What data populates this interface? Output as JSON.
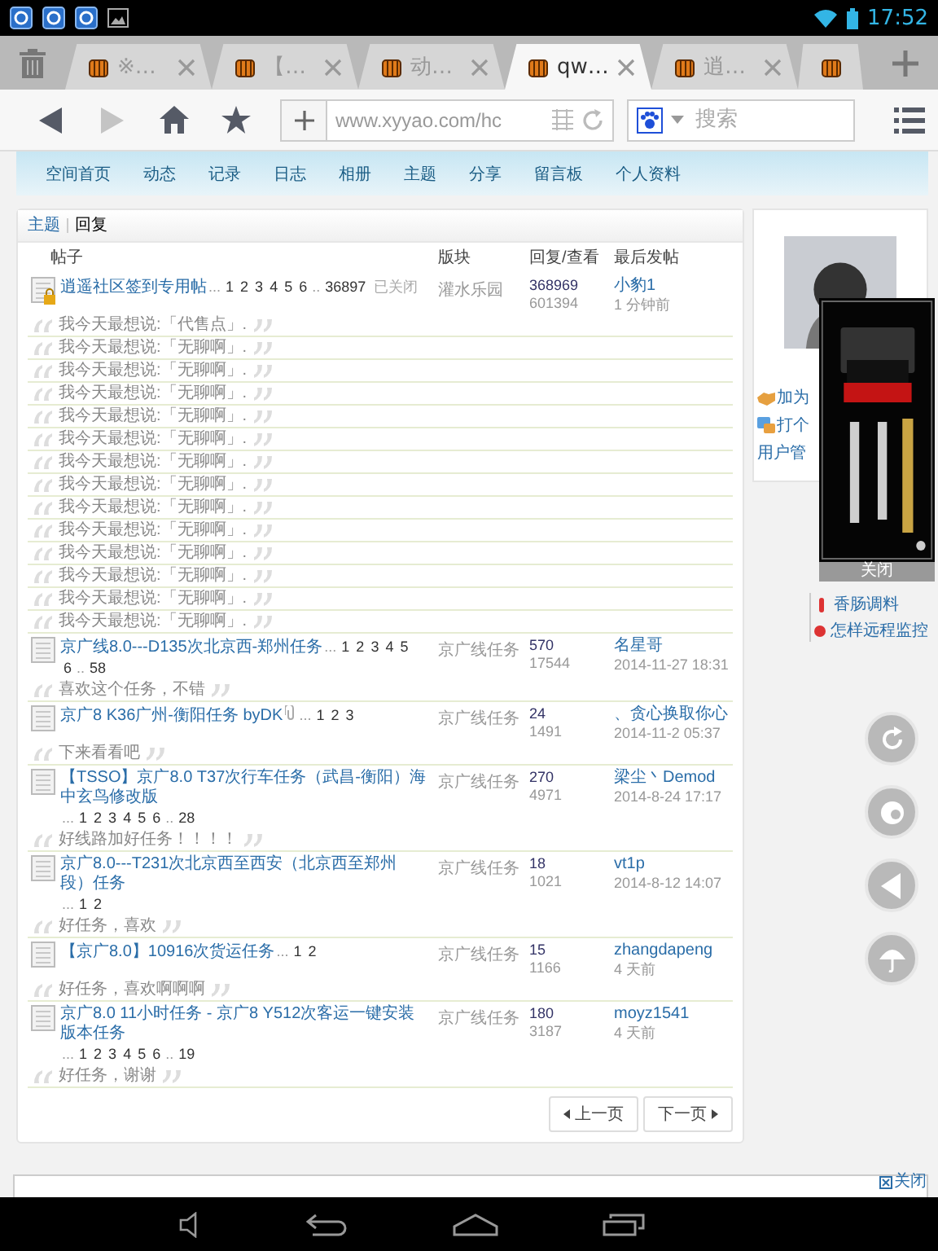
{
  "status_bar": {
    "time": "17:52"
  },
  "browser_tabs": [
    {
      "title": "※…",
      "selected": false
    },
    {
      "title": "【…",
      "selected": false
    },
    {
      "title": "动…",
      "selected": false
    },
    {
      "title": "qw…",
      "selected": true
    },
    {
      "title": "逍…",
      "selected": false
    },
    {
      "selected": false
    }
  ],
  "toolbar": {
    "forward_disabled": true,
    "address": "www.xyyao.com/hc",
    "search": {
      "placeholder": "搜索"
    }
  },
  "nav": [
    "空间首页",
    "动态",
    "记录",
    "日志",
    "相册",
    "主题",
    "分享",
    "留言板",
    "个人资料"
  ],
  "breadcrumb": {
    "link": "主题",
    "current": "回复"
  },
  "columns": [
    "帖子",
    "版块",
    "回复/查看",
    "最后发帖"
  ],
  "threads": [
    {
      "title": "逍遥社区签到专用帖",
      "locked": true,
      "attachment": false,
      "pages": [
        {
          "kind": "gap",
          "text": "..."
        },
        {
          "kind": "page",
          "text": "1"
        },
        {
          "kind": "page",
          "text": "2"
        },
        {
          "kind": "page",
          "text": "3"
        },
        {
          "kind": "page",
          "text": "4"
        },
        {
          "kind": "page",
          "text": "5"
        },
        {
          "kind": "page",
          "text": "6"
        },
        {
          "kind": "gap",
          "text": ".."
        },
        {
          "kind": "page",
          "text": "36897"
        }
      ],
      "status": "已关闭",
      "forum": "灌水乐园",
      "replies": "368969",
      "views": "601394",
      "last_poster": "小豹1",
      "last_time": "1 分钟前",
      "quotes": [
        "我今天最想说:「代售点」.",
        "我今天最想说:「无聊啊」.",
        "我今天最想说:「无聊啊」.",
        "我今天最想说:「无聊啊」.",
        "我今天最想说:「无聊啊」.",
        "我今天最想说:「无聊啊」.",
        "我今天最想说:「无聊啊」.",
        "我今天最想说:「无聊啊」.",
        "我今天最想说:「无聊啊」.",
        "我今天最想说:「无聊啊」.",
        "我今天最想说:「无聊啊」.",
        "我今天最想说:「无聊啊」.",
        "我今天最想说:「无聊啊」.",
        "我今天最想说:「无聊啊」."
      ]
    },
    {
      "title": "京广线8.0---D135次北京西-郑州任务",
      "locked": false,
      "attachment": false,
      "pages": [
        {
          "kind": "gap",
          "text": "..."
        },
        {
          "kind": "page",
          "text": "1"
        },
        {
          "kind": "page",
          "text": "2"
        },
        {
          "kind": "page",
          "text": "3"
        },
        {
          "kind": "page",
          "text": "4"
        },
        {
          "kind": "page",
          "text": "5"
        },
        {
          "kind": "page",
          "text": "6"
        },
        {
          "kind": "gap",
          "text": ".."
        },
        {
          "kind": "page",
          "text": "58"
        }
      ],
      "forum": "京广线任务",
      "replies": "570",
      "views": "17544",
      "last_poster": "名星哥",
      "last_time": "2014-11-27 18:31",
      "quotes": [
        "喜欢这个任务，不错"
      ]
    },
    {
      "title": "京广8 K36广州-衡阳任务 byDK",
      "locked": false,
      "attachment": true,
      "pages": [
        {
          "kind": "gap",
          "text": "..."
        },
        {
          "kind": "page",
          "text": "1"
        },
        {
          "kind": "page",
          "text": "2"
        },
        {
          "kind": "page",
          "text": "3"
        }
      ],
      "forum": "京广线任务",
      "replies": "24",
      "views": "1491",
      "last_poster": "、贪心换取你心",
      "last_time": "2014-11-2 05:37",
      "quotes": [
        "下来看看吧"
      ]
    },
    {
      "title": "【TSSO】京广8.0 T37次行车任务（武昌-衡阳）海中玄鸟修改版",
      "locked": false,
      "attachment": false,
      "pages": [
        {
          "kind": "gap",
          "text": "..."
        },
        {
          "kind": "page",
          "text": "1"
        },
        {
          "kind": "page",
          "text": "2"
        },
        {
          "kind": "page",
          "text": "3"
        },
        {
          "kind": "page",
          "text": "4"
        },
        {
          "kind": "page",
          "text": "5"
        },
        {
          "kind": "page",
          "text": "6"
        },
        {
          "kind": "gap",
          "text": ".."
        },
        {
          "kind": "page",
          "text": "28"
        }
      ],
      "forum": "京广线任务",
      "replies": "270",
      "views": "4971",
      "last_poster": "梁尘丶Demod",
      "last_time": "2014-8-24 17:17",
      "quotes": [
        "好线路加好任务！！！！"
      ]
    },
    {
      "title": "京广8.0---T231次北京西至西安（北京西至郑州段）任务",
      "locked": false,
      "attachment": false,
      "pages": [
        {
          "kind": "gap",
          "text": "..."
        },
        {
          "kind": "page",
          "text": "1"
        },
        {
          "kind": "page",
          "text": "2"
        }
      ],
      "forum": "京广线任务",
      "replies": "18",
      "views": "1021",
      "last_poster": "vt1p",
      "last_time": "2014-8-12 14:07",
      "quotes": [
        "好任务，喜欢"
      ]
    },
    {
      "title": "【京广8.0】10916次货运任务",
      "locked": false,
      "attachment": false,
      "pages": [
        {
          "kind": "gap",
          "text": "..."
        },
        {
          "kind": "page",
          "text": "1"
        },
        {
          "kind": "page",
          "text": "2"
        }
      ],
      "forum": "京广线任务",
      "replies": "15",
      "views": "1166",
      "last_poster": "zhangdapeng",
      "last_time": "4 天前",
      "quotes": [
        "好任务，喜欢啊啊啊"
      ]
    },
    {
      "title": "京广8.0 11小时任务 - 京广8 Y512次客运一键安装版本任务",
      "locked": false,
      "attachment": false,
      "pages": [
        {
          "kind": "gap",
          "text": "..."
        },
        {
          "kind": "page",
          "text": "1"
        },
        {
          "kind": "page",
          "text": "2"
        },
        {
          "kind": "page",
          "text": "3"
        },
        {
          "kind": "page",
          "text": "4"
        },
        {
          "kind": "page",
          "text": "5"
        },
        {
          "kind": "page",
          "text": "6"
        },
        {
          "kind": "gap",
          "text": ".."
        },
        {
          "kind": "page",
          "text": "19"
        }
      ],
      "forum": "京广线任务",
      "replies": "180",
      "views": "3187",
      "last_poster": "moyz1541",
      "last_time": "4 天前",
      "quotes": [
        "好任务，谢谢"
      ]
    }
  ],
  "pagination": {
    "prev": "上一页",
    "next": "下一页"
  },
  "profile_links": [
    "加为",
    "打个",
    "用户管"
  ],
  "ad": {
    "kind": "picture",
    "close": "关闭"
  },
  "related_links": [
    "香肠调料",
    "怎样远程监控"
  ],
  "bottom_strip": {
    "close": "关闭"
  }
}
